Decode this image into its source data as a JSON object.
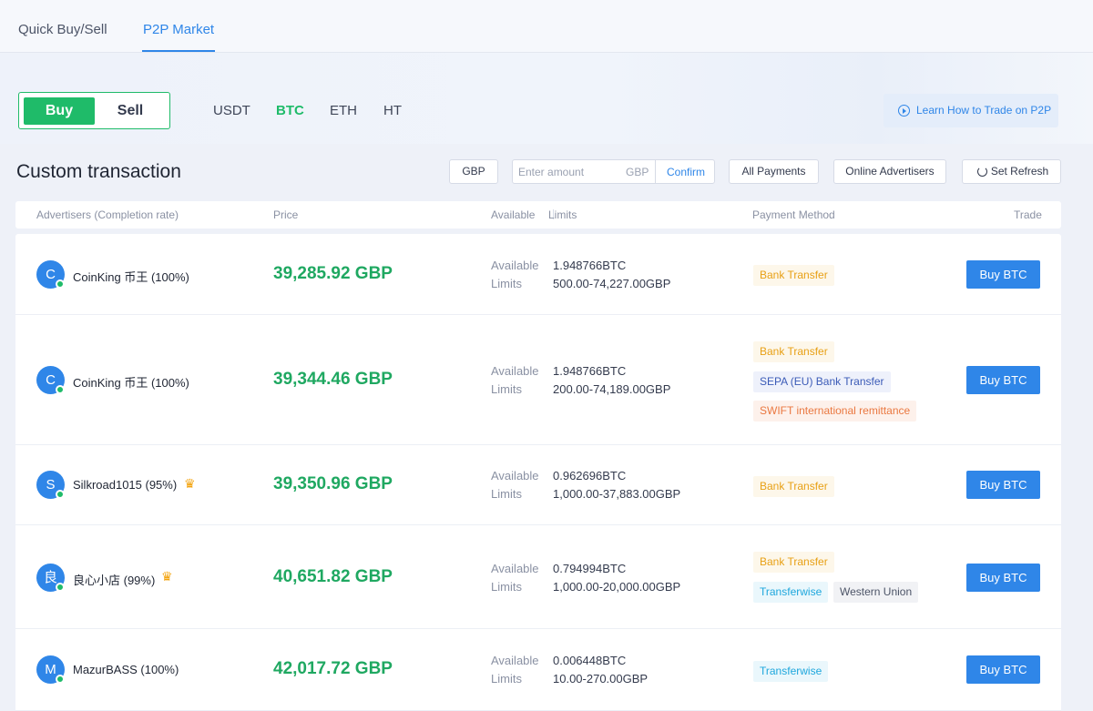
{
  "tabs": [
    "Quick Buy/Sell",
    "P2P Market"
  ],
  "toggle": {
    "buy": "Buy",
    "sell": "Sell"
  },
  "coins": [
    "USDT",
    "BTC",
    "ETH",
    "HT"
  ],
  "learn_label": "Learn How to Trade on P2P",
  "section_title": "Custom transaction",
  "filters": {
    "currency": "GBP",
    "amount_placeholder": "Enter amount",
    "amount_currency": "GBP",
    "confirm": "Confirm",
    "payments": "All Payments",
    "online": "Online Advertisers",
    "refresh": "Set Refresh"
  },
  "columns": {
    "advertisers": "Advertisers (Completion rate)",
    "price": "Price",
    "available": "Available",
    "limits": "Limits",
    "payment": "Payment Method",
    "trade": "Trade"
  },
  "labels": {
    "available": "Available",
    "limits": "Limits"
  },
  "rows": [
    {
      "initial": "C",
      "name": "CoinKing 币王 (100%)",
      "crown": false,
      "price": "39,285.92 GBP",
      "available": "1.948766BTC",
      "limits": "500.00-74,227.00GBP",
      "payments": [
        "Bank Transfer"
      ],
      "button": "Buy BTC"
    },
    {
      "initial": "C",
      "name": "CoinKing 币王 (100%)",
      "crown": false,
      "price": "39,344.46 GBP",
      "available": "1.948766BTC",
      "limits": "200.00-74,189.00GBP",
      "payments": [
        "Bank Transfer",
        "SEPA (EU) Bank Transfer",
        "SWIFT international remittance"
      ],
      "button": "Buy BTC"
    },
    {
      "initial": "S",
      "name": "Silkroad1015 (95%)",
      "crown": true,
      "price": "39,350.96 GBP",
      "available": "0.962696BTC",
      "limits": "1,000.00-37,883.00GBP",
      "payments": [
        "Bank Transfer"
      ],
      "button": "Buy BTC"
    },
    {
      "initial": "良",
      "name": "良心小店 (99%)",
      "crown": true,
      "price": "40,651.82 GBP",
      "available": "0.794994BTC",
      "limits": "1,000.00-20,000.00GBP",
      "payments": [
        "Bank Transfer",
        "Transferwise",
        "Western Union"
      ],
      "button": "Buy BTC"
    },
    {
      "initial": "M",
      "name": "MazurBASS (100%)",
      "crown": false,
      "price": "42,017.72 GBP",
      "available": "0.006448BTC",
      "limits": "10.00-270.00GBP",
      "payments": [
        "Transferwise"
      ],
      "button": "Buy BTC"
    }
  ],
  "icons": {
    "play": "play-circle-icon",
    "refresh": "refresh-icon",
    "crown": "crown-icon",
    "online": "online-dot-icon"
  },
  "colors": {
    "accent_green": "#1fbb69",
    "price_green": "#1fa861",
    "accent_blue": "#2f86e8"
  }
}
